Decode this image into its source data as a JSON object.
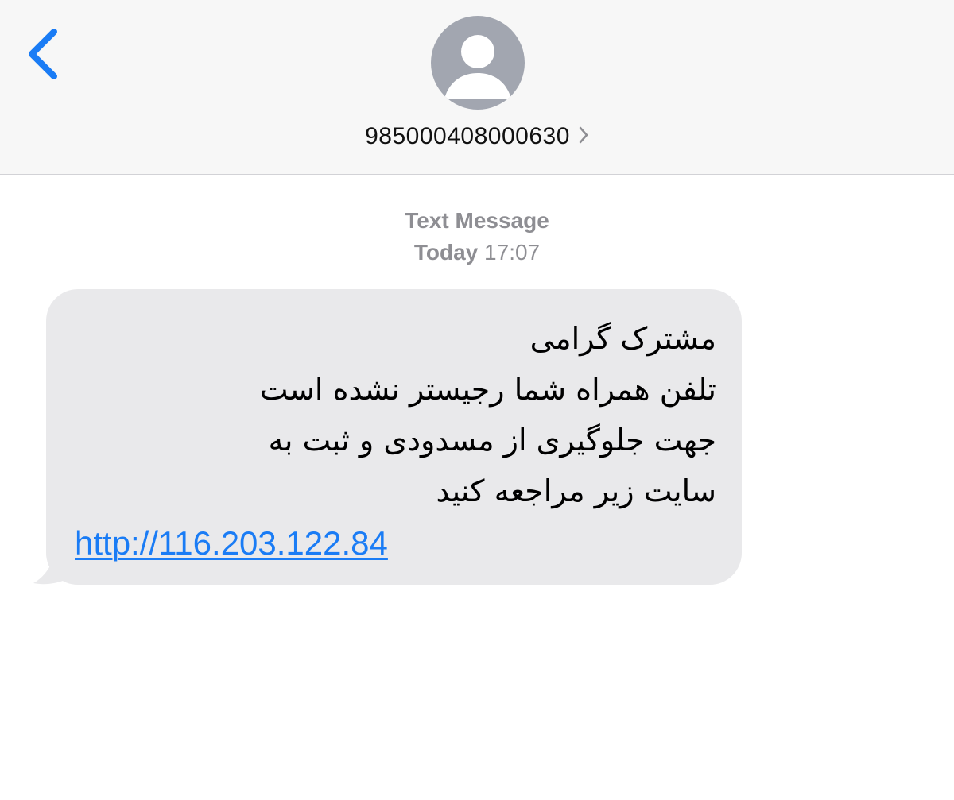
{
  "header": {
    "back_icon": "chevron-left-icon",
    "avatar_icon": "person-silhouette-icon",
    "contact_number": "985000408000630",
    "contact_chevron_icon": "chevron-right-icon"
  },
  "conversation": {
    "service_label": "Text Message",
    "day_label": "Today",
    "time_label": "17:07"
  },
  "message": {
    "lines": [
      "مشترک گرامی",
      "تلفن همراه شما رجیستر نشده است",
      "جهت جلوگیری از مسدودی و ثبت به",
      "سایت زیر مراجعه کنید"
    ],
    "link": "http://116.203.122.84"
  },
  "colors": {
    "accent_blue": "#1a7cf5",
    "bubble_gray": "#e9e9eb",
    "header_bg": "#f7f7f7",
    "avatar_gray": "#a2a6b0",
    "meta_gray": "#8e8e93"
  }
}
